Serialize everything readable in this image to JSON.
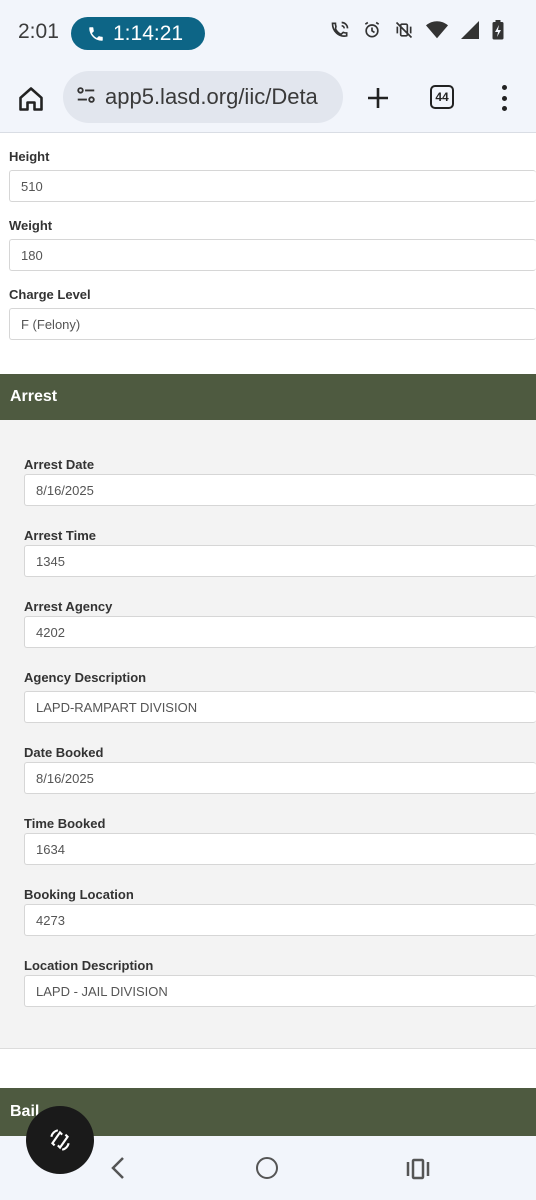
{
  "status_bar": {
    "time": "2:01",
    "call_timer": "1:14:21",
    "icons": [
      "wifi-calling-icon",
      "alarm-icon",
      "vibrate-off-icon",
      "wifi-icon",
      "signal-icon",
      "battery-icon"
    ]
  },
  "browser": {
    "url": "app5.lasd.org/iic/Deta",
    "tab_count": "44",
    "icons": [
      "home-icon",
      "site-settings-icon",
      "new-tab-icon",
      "more-icon"
    ]
  },
  "top_fields": [
    {
      "label": "Height",
      "value": "510"
    },
    {
      "label": "Weight",
      "value": "180"
    },
    {
      "label": "Charge Level",
      "value": "F (Felony)"
    }
  ],
  "arrest": {
    "title": "Arrest",
    "fields": [
      {
        "label": "Arrest Date",
        "value": "8/16/2025"
      },
      {
        "label": "Arrest Time",
        "value": "1345"
      },
      {
        "label": "Arrest Agency",
        "value": "4202"
      },
      {
        "label": "Agency Description",
        "value": "LAPD-RAMPART DIVISION"
      },
      {
        "label": "Date Booked",
        "value": "8/16/2025"
      },
      {
        "label": "Time Booked",
        "value": "1634"
      },
      {
        "label": "Booking Location",
        "value": "4273"
      },
      {
        "label": "Location Description",
        "value": "LAPD - JAIL DIVISION"
      }
    ]
  },
  "bail": {
    "title": "Bail"
  },
  "colors": {
    "section_header": "#4e5a40",
    "call_pill": "#0d6586",
    "panel_bg": "#f3f3f3"
  }
}
